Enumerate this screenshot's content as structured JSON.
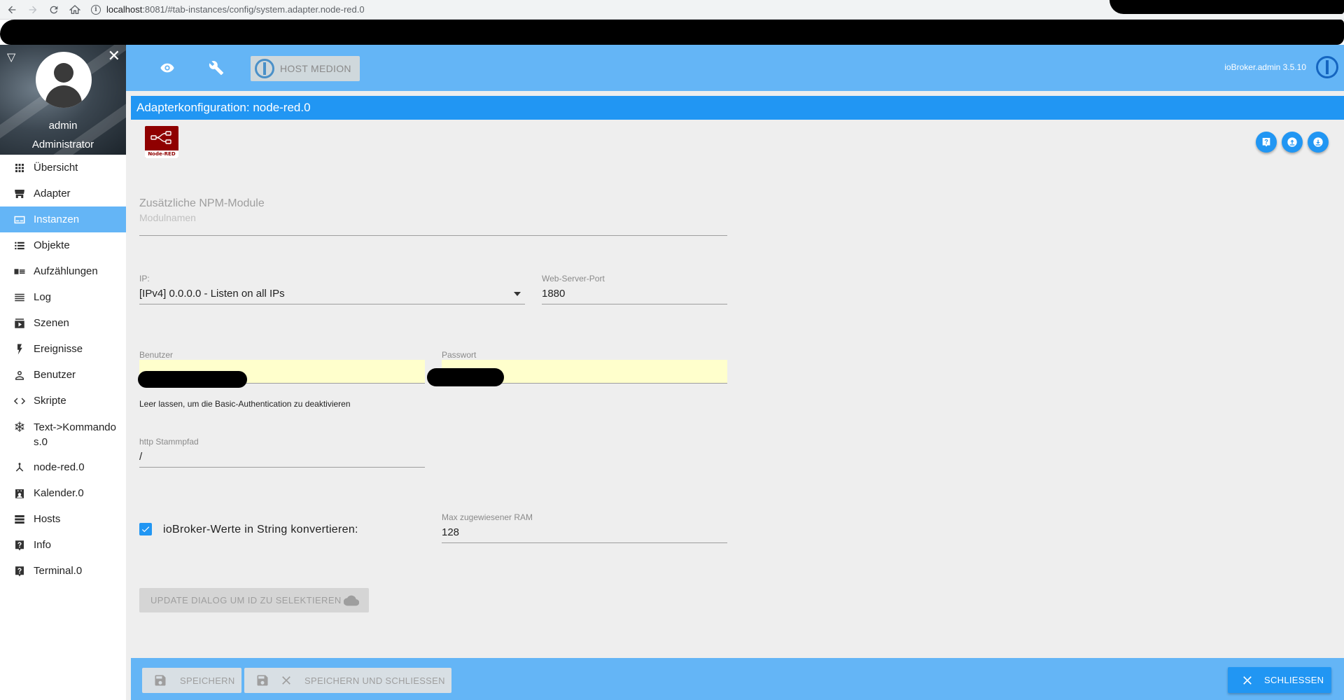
{
  "browser": {
    "url_host": "localhost",
    "url_path": ":8081/#tab-instances/config/system.adapter.node-red.0"
  },
  "sidebar": {
    "user_name": "admin",
    "user_role": "Administrator",
    "items": [
      {
        "label": "Übersicht",
        "icon": "grid-icon"
      },
      {
        "label": "Adapter",
        "icon": "store-icon"
      },
      {
        "label": "Instanzen",
        "icon": "instances-icon",
        "active": true
      },
      {
        "label": "Objekte",
        "icon": "list-icon"
      },
      {
        "label": "Aufzählungen",
        "icon": "enum-icon"
      },
      {
        "label": "Log",
        "icon": "log-icon"
      },
      {
        "label": "Szenen",
        "icon": "scenes-icon"
      },
      {
        "label": "Ereignisse",
        "icon": "flash-icon"
      },
      {
        "label": "Benutzer",
        "icon": "person-icon"
      },
      {
        "label": "Skripte",
        "icon": "code-icon"
      },
      {
        "label": "Text->Kommandos.0",
        "icon": "snowflake-icon"
      },
      {
        "label": "node-red.0",
        "icon": "node-red-icon"
      },
      {
        "label": "Kalender.0",
        "icon": "calendar-icon"
      },
      {
        "label": "Hosts",
        "icon": "hosts-icon"
      },
      {
        "label": "Info",
        "icon": "help-icon"
      },
      {
        "label": "Terminal.0",
        "icon": "help-icon"
      }
    ]
  },
  "topbar": {
    "host_label": "HOST MEDION",
    "version": "ioBroker.admin 3.5.10"
  },
  "config": {
    "title": "Adapterkonfiguration: node-red.0",
    "adapter_logo_text": "Node-RED",
    "npm_label": "Zusätzliche NPM-Module",
    "npm_placeholder": "Modulnamen",
    "ip_label": "IP:",
    "ip_value": "[IPv4] 0.0.0.0 - Listen on all IPs",
    "port_label": "Web-Server-Port",
    "port_value": "1880",
    "user_label": "Benutzer",
    "password_label": "Passwort",
    "auth_help": "Leer lassen, um die Basic-Authentication zu deaktivieren",
    "root_label": "http Stammpfad",
    "root_value": "/",
    "string_label": "ioBroker-Werte in String konvertieren:",
    "string_checked": true,
    "ram_label": "Max zugewiesener RAM",
    "ram_value": "128",
    "update_button": "UPDATE DIALOG UM ID ZU SELEKTIEREN"
  },
  "footer": {
    "save": "SPEICHERN",
    "save_close": "SPEICHERN UND SCHLIESSEN",
    "close": "SCHLIESSEN"
  },
  "colors": {
    "primary": "#2196f3",
    "topbar": "#64b5f6",
    "content_bg": "#eeeeee",
    "highlight_input": "#ffffcc"
  }
}
